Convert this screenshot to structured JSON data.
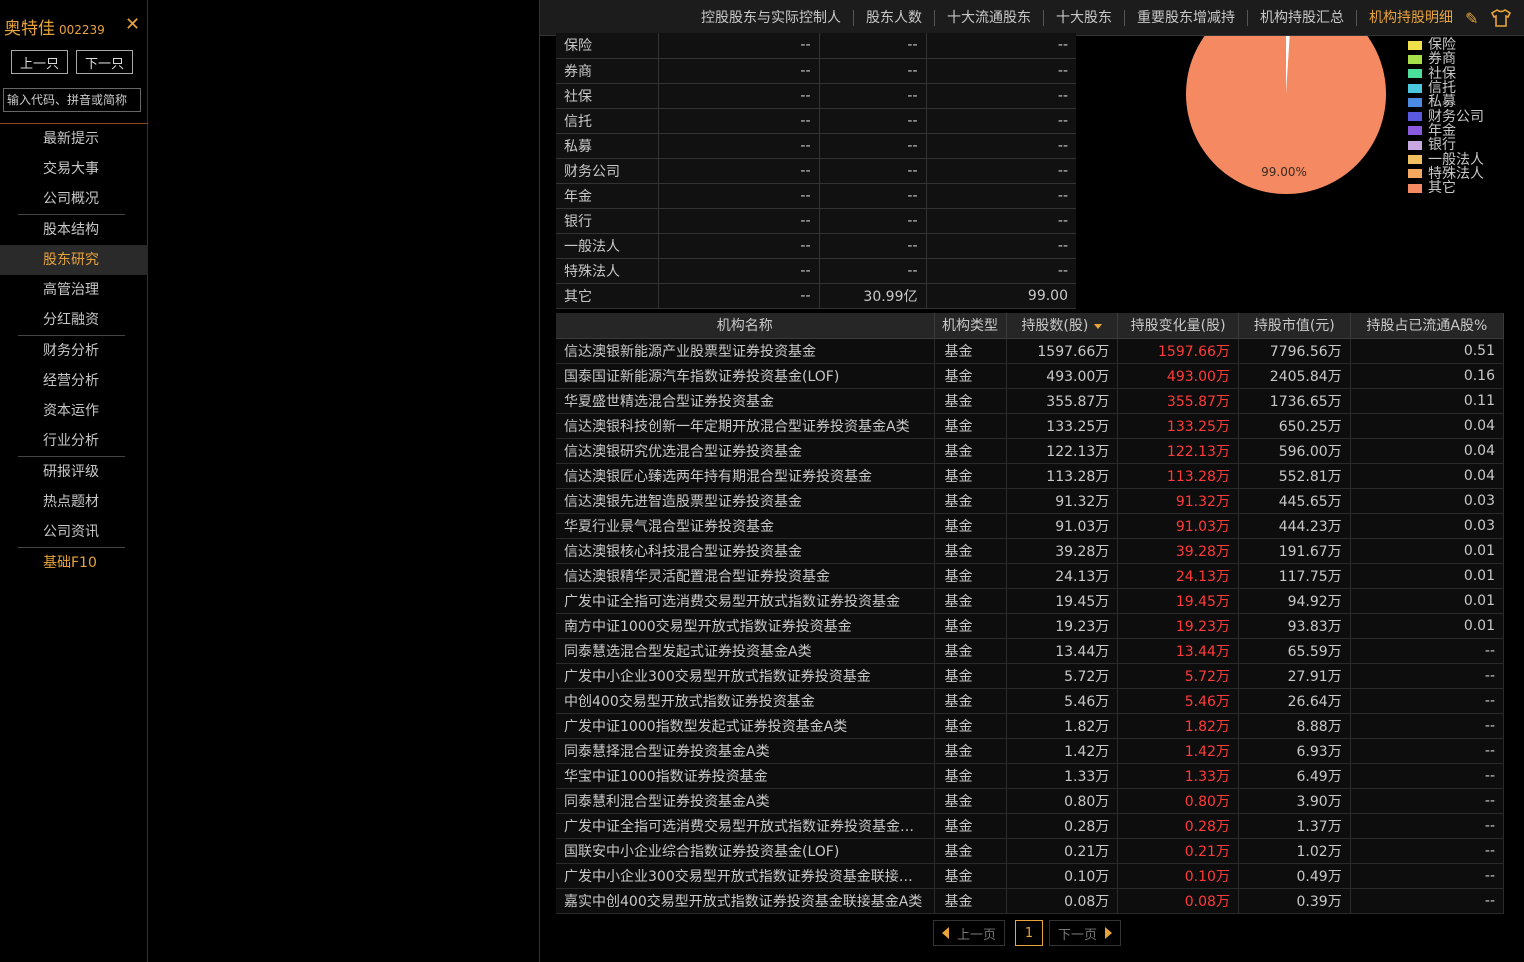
{
  "sidebar": {
    "stock_name": "奥特佳",
    "stock_code": "002239",
    "close_icon": "close-icon",
    "prev_label": "上一只",
    "next_label": "下一只",
    "search_placeholder": "输入代码、拼音或简称",
    "menu_groups": [
      [
        "最新提示",
        "交易大事",
        "公司概况"
      ],
      [
        "股本结构",
        "股东研究",
        "高管治理",
        "分红融资"
      ],
      [
        "财务分析",
        "经营分析",
        "资本运作",
        "行业分析"
      ],
      [
        "研报评级",
        "热点题材",
        "公司资讯"
      ],
      [
        "基础F10"
      ]
    ],
    "active_item": "股东研究"
  },
  "topbar": {
    "tabs": [
      "控股股东与实际控制人",
      "股东人数",
      "十大流通股东",
      "十大股东",
      "重要股东增减持",
      "机构持股汇总",
      "机构持股明细"
    ],
    "active_tab": "机构持股明细",
    "icons": [
      "edit-icon",
      "shirt-icon"
    ]
  },
  "summary": {
    "rows": [
      [
        "保险",
        "--",
        "--",
        "--"
      ],
      [
        "券商",
        "--",
        "--",
        "--"
      ],
      [
        "社保",
        "--",
        "--",
        "--"
      ],
      [
        "信托",
        "--",
        "--",
        "--"
      ],
      [
        "私募",
        "--",
        "--",
        "--"
      ],
      [
        "财务公司",
        "--",
        "--",
        "--"
      ],
      [
        "年金",
        "--",
        "--",
        "--"
      ],
      [
        "银行",
        "--",
        "--",
        "--"
      ],
      [
        "一般法人",
        "--",
        "--",
        "--"
      ],
      [
        "特殊法人",
        "--",
        "--",
        "--"
      ],
      [
        "其它",
        "--",
        "30.99亿",
        "99.00"
      ]
    ]
  },
  "chart_data": {
    "type": "pie",
    "slices": [
      {
        "label": "保险",
        "value": 0,
        "color": "#f0e04a"
      },
      {
        "label": "券商",
        "value": 0,
        "color": "#a8e04a"
      },
      {
        "label": "社保",
        "value": 0,
        "color": "#4ae09a"
      },
      {
        "label": "信托",
        "value": 0,
        "color": "#4ac8e0"
      },
      {
        "label": "私募",
        "value": 0,
        "color": "#4a8ae0"
      },
      {
        "label": "财务公司",
        "value": 0,
        "color": "#5a5ae0"
      },
      {
        "label": "年金",
        "value": 0,
        "color": "#8a5ae0"
      },
      {
        "label": "银行",
        "value": 0,
        "color": "#c8a8e0"
      },
      {
        "label": "一般法人",
        "value": 0,
        "color": "#f0c060"
      },
      {
        "label": "特殊法人",
        "value": 0,
        "color": "#f5a860"
      },
      {
        "label": "其它",
        "value": 99.0,
        "color": "#f58a62"
      }
    ],
    "other_slice_value": 1.0,
    "data_label": "99.00%"
  },
  "detail": {
    "headers": [
      "机构名称",
      "机构类型",
      "持股数(股)",
      "持股变化量(股)",
      "持股市值(元)",
      "持股占已流通A股%"
    ],
    "rows": [
      [
        "信达澳银新能源产业股票型证券投资基金",
        "基金",
        "1597.66万",
        "1597.66万",
        "7796.56万",
        "0.51"
      ],
      [
        "国泰国证新能源汽车指数证券投资基金(LOF)",
        "基金",
        "493.00万",
        "493.00万",
        "2405.84万",
        "0.16"
      ],
      [
        "华夏盛世精选混合型证券投资基金",
        "基金",
        "355.87万",
        "355.87万",
        "1736.65万",
        "0.11"
      ],
      [
        "信达澳银科技创新一年定期开放混合型证券投资基金A类",
        "基金",
        "133.25万",
        "133.25万",
        "650.25万",
        "0.04"
      ],
      [
        "信达澳银研究优选混合型证券投资基金",
        "基金",
        "122.13万",
        "122.13万",
        "596.00万",
        "0.04"
      ],
      [
        "信达澳银匠心臻选两年持有期混合型证券投资基金",
        "基金",
        "113.28万",
        "113.28万",
        "552.81万",
        "0.04"
      ],
      [
        "信达澳银先进智造股票型证券投资基金",
        "基金",
        "91.32万",
        "91.32万",
        "445.65万",
        "0.03"
      ],
      [
        "华夏行业景气混合型证券投资基金",
        "基金",
        "91.03万",
        "91.03万",
        "444.23万",
        "0.03"
      ],
      [
        "信达澳银核心科技混合型证券投资基金",
        "基金",
        "39.28万",
        "39.28万",
        "191.67万",
        "0.01"
      ],
      [
        "信达澳银精华灵活配置混合型证券投资基金",
        "基金",
        "24.13万",
        "24.13万",
        "117.75万",
        "0.01"
      ],
      [
        "广发中证全指可选消费交易型开放式指数证券投资基金",
        "基金",
        "19.45万",
        "19.45万",
        "94.92万",
        "0.01"
      ],
      [
        "南方中证1000交易型开放式指数证券投资基金",
        "基金",
        "19.23万",
        "19.23万",
        "93.83万",
        "0.01"
      ],
      [
        "同泰慧选混合型发起式证券投资基金A类",
        "基金",
        "13.44万",
        "13.44万",
        "65.59万",
        "--"
      ],
      [
        "广发中小企业300交易型开放式指数证券投资基金",
        "基金",
        "5.72万",
        "5.72万",
        "27.91万",
        "--"
      ],
      [
        "中创400交易型开放式指数证券投资基金",
        "基金",
        "5.46万",
        "5.46万",
        "26.64万",
        "--"
      ],
      [
        "广发中证1000指数型发起式证券投资基金A类",
        "基金",
        "1.82万",
        "1.82万",
        "8.88万",
        "--"
      ],
      [
        "同泰慧择混合型证券投资基金A类",
        "基金",
        "1.42万",
        "1.42万",
        "6.93万",
        "--"
      ],
      [
        "华宝中证1000指数证券投资基金",
        "基金",
        "1.33万",
        "1.33万",
        "6.49万",
        "--"
      ],
      [
        "同泰慧利混合型证券投资基金A类",
        "基金",
        "0.80万",
        "0.80万",
        "3.90万",
        "--"
      ],
      [
        "广发中证全指可选消费交易型开放式指数证券投资基金发...",
        "基金",
        "0.28万",
        "0.28万",
        "1.37万",
        "--"
      ],
      [
        "国联安中小企业综合指数证券投资基金(LOF)",
        "基金",
        "0.21万",
        "0.21万",
        "1.02万",
        "--"
      ],
      [
        "广发中小企业300交易型开放式指数证券投资基金联接基金...",
        "基金",
        "0.10万",
        "0.10万",
        "0.49万",
        "--"
      ],
      [
        "嘉实中创400交易型开放式指数证券投资基金联接基金A类",
        "基金",
        "0.08万",
        "0.08万",
        "0.39万",
        "--"
      ]
    ]
  },
  "pager": {
    "prev_label": "上一页",
    "current_page": "1",
    "next_label": "下一页"
  }
}
